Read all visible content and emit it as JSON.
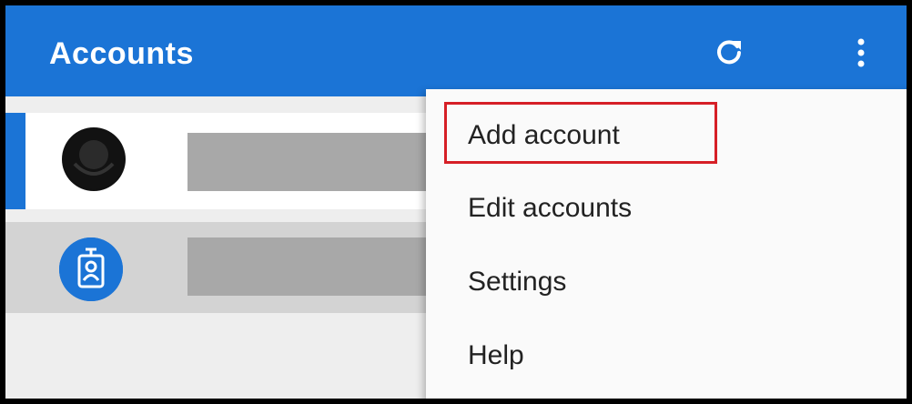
{
  "appbar": {
    "title": "Accounts",
    "icons": [
      "refresh-icon",
      "more-vert-icon"
    ]
  },
  "accounts": [
    {
      "avatar": "dark-emblem-avatar",
      "selected": true
    },
    {
      "avatar": "badge-avatar",
      "selected": false
    }
  ],
  "menu": {
    "items": [
      {
        "label": "Add account"
      },
      {
        "label": "Edit accounts"
      },
      {
        "label": "Settings"
      },
      {
        "label": "Help"
      }
    ]
  },
  "colors": {
    "accent": "#1b74d6",
    "highlight": "#d61f26"
  }
}
